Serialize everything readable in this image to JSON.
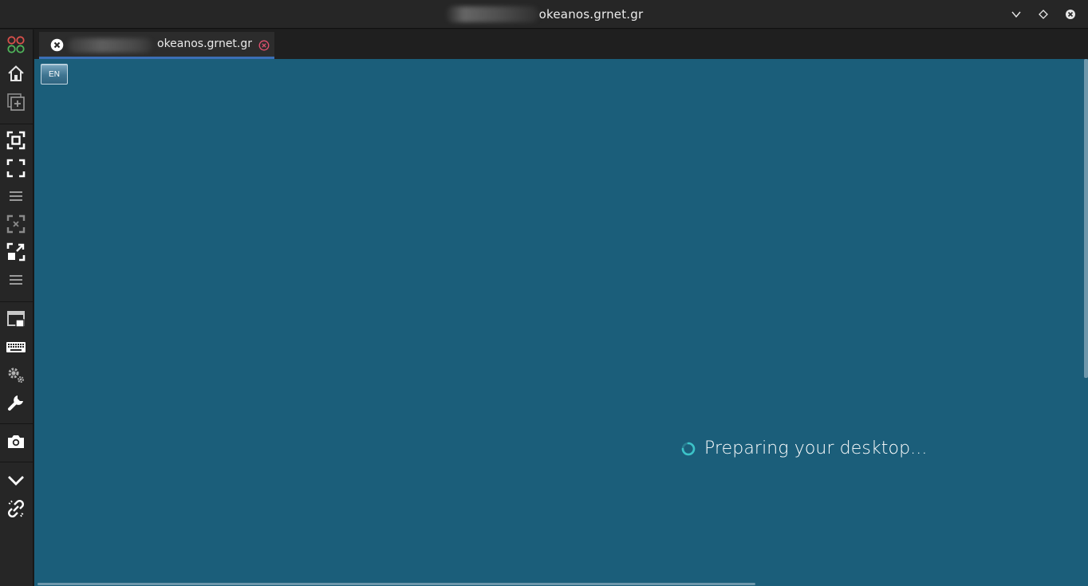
{
  "window": {
    "title": "okeanos.grnet.gr"
  },
  "sidebar": {
    "items": [
      {
        "name": "connections-icon"
      },
      {
        "name": "home-icon"
      },
      {
        "name": "new-connection-icon"
      },
      {
        "name": "fit-window-icon"
      },
      {
        "name": "fullscreen-icon"
      },
      {
        "name": "menu-icon"
      },
      {
        "name": "scaled-mode-icon"
      },
      {
        "name": "dynamic-resize-icon"
      },
      {
        "name": "menu-icon"
      },
      {
        "name": "multi-monitor-icon"
      },
      {
        "name": "keyboard-icon"
      },
      {
        "name": "settings-icon"
      },
      {
        "name": "tools-icon"
      },
      {
        "name": "screenshot-icon"
      },
      {
        "name": "minimize-toolbar-icon"
      },
      {
        "name": "disconnect-icon"
      }
    ]
  },
  "tabs": [
    {
      "label": "okeanos.grnet.gr"
    }
  ],
  "remote": {
    "language_button": "EN",
    "status_text": "Preparing your desktop..."
  },
  "colors": {
    "desktop_background": "#1b5e7a",
    "active_tab_indicator": "#3b6fb6",
    "tab_close": "#e0506e",
    "spinner": "#3cc3c8"
  }
}
